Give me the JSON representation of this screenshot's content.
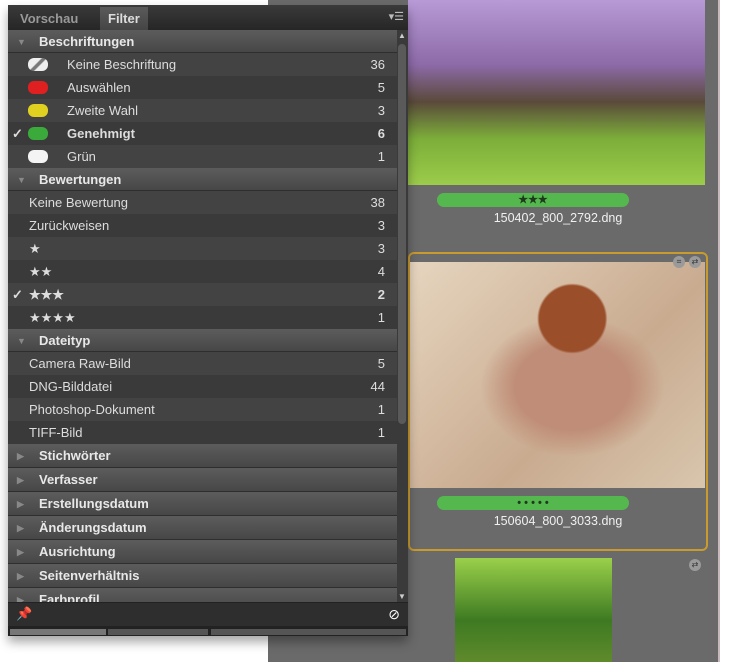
{
  "tabs": {
    "preview": "Vorschau",
    "filter": "Filter"
  },
  "menu_icon": "panel-menu-icon",
  "labels": {
    "title": "Beschriftungen",
    "items": [
      {
        "label": "Keine Beschriftung",
        "count": "36",
        "color": "#dddddd",
        "checked": false
      },
      {
        "label": "Auswählen",
        "count": "5",
        "color": "#e02020",
        "checked": false
      },
      {
        "label": "Zweite Wahl",
        "count": "3",
        "color": "#e0d020",
        "checked": false
      },
      {
        "label": "Genehmigt",
        "count": "6",
        "color": "#3aaa3a",
        "checked": true
      },
      {
        "label": "Grün",
        "count": "1",
        "color": "#f4f4f4",
        "checked": false
      }
    ]
  },
  "ratings": {
    "title": "Bewertungen",
    "items": [
      {
        "label": "Keine Bewertung",
        "count": "38",
        "checked": false
      },
      {
        "label": "Zurückweisen",
        "count": "3",
        "checked": false
      },
      {
        "label": "★",
        "count": "3",
        "checked": false
      },
      {
        "label": "★★",
        "count": "4",
        "checked": false
      },
      {
        "label": "★★★",
        "count": "2",
        "checked": true
      },
      {
        "label": "★★★★",
        "count": "1",
        "checked": false
      }
    ]
  },
  "filetype": {
    "title": "Dateityp",
    "items": [
      {
        "label": "Camera Raw-Bild",
        "count": "5"
      },
      {
        "label": "DNG-Bilddatei",
        "count": "44"
      },
      {
        "label": "Photoshop-Dokument",
        "count": "1"
      },
      {
        "label": "TIFF-Bild",
        "count": "1"
      }
    ]
  },
  "collapsed": [
    "Stichwörter",
    "Verfasser",
    "Erstellungsdatum",
    "Änderungsdatum",
    "Ausrichtung",
    "Seitenverhältnis",
    "Farbprofil"
  ],
  "check_mark": "✓",
  "thumbnails": [
    {
      "rating": "★★★",
      "filename": "150402_800_2792.dng"
    },
    {
      "rating": "• • • • •",
      "filename": "150604_800_3033.dng"
    }
  ]
}
